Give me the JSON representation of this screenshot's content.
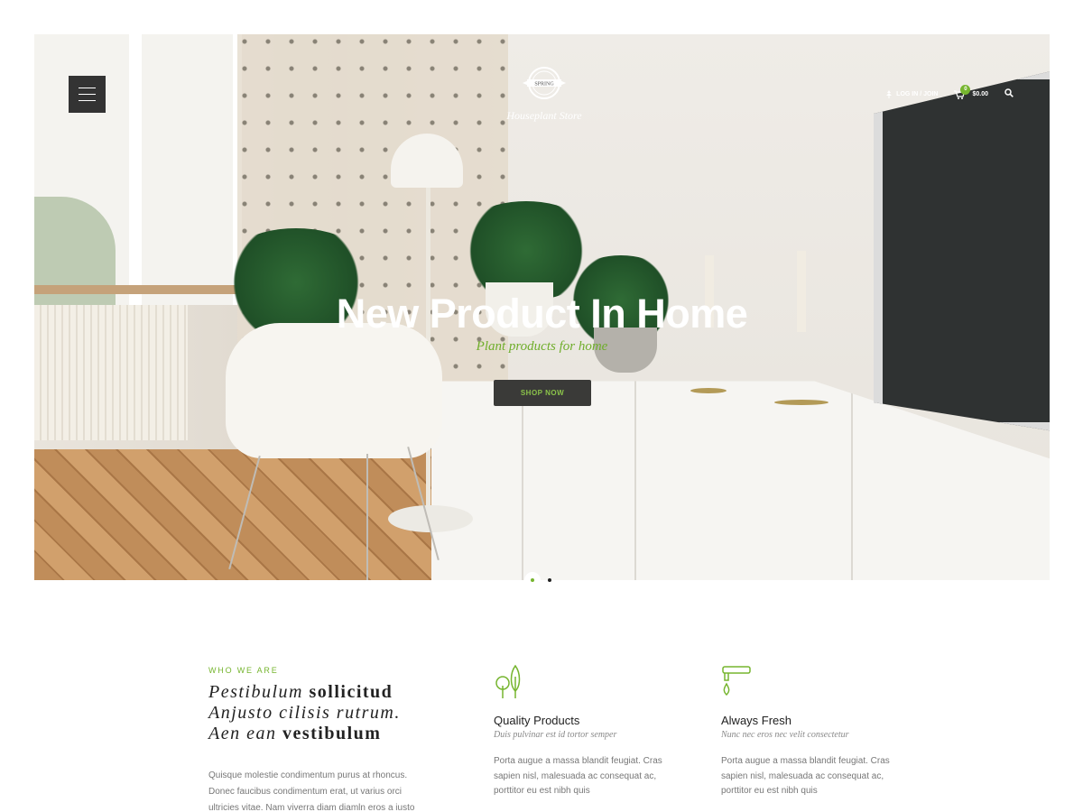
{
  "header": {
    "brand_tagline": "Houseplant Store",
    "login_label": "LOG IN / JOIN",
    "cart_count": "0",
    "cart_total": "$0.00"
  },
  "hero": {
    "title": "New Product In Home",
    "subtitle": "Plant products for home",
    "cta_label": "SHOP NOW",
    "slides_total": 2,
    "active_slide": 1
  },
  "about": {
    "eyebrow": "WHO WE ARE",
    "line1_italic": "Pestibulum ",
    "line1_bold": "sollicitud",
    "line2_italic": "Anjusto cilisis rutrum.",
    "line3_italic": "Aen ean ",
    "line3_bold": "vestibulum",
    "body": "Quisque molestie condimentum purus at rhoncus. Donec faucibus condimentum erat, ut varius orci ultricies vitae. Nam viverra diam diamln eros a iusto"
  },
  "features": [
    {
      "icon": "trees-icon",
      "title": "Quality Products",
      "subtitle": "Duis pulvinar est id tortor semper",
      "body": "Porta augue a massa blandit feugiat. Cras sapien nisl, malesuada ac consequat ac, porttitor eu est nibh quis"
    },
    {
      "icon": "water-tap-icon",
      "title": "Always Fresh",
      "subtitle": "Nunc nec eros nec velit consectetur",
      "body": "Porta augue a massa blandit feugiat. Cras sapien nisl, malesuada ac consequat ac, porttitor eu est nibh quis"
    }
  ],
  "colors": {
    "accent": "#76b52f",
    "dark": "#333333"
  }
}
